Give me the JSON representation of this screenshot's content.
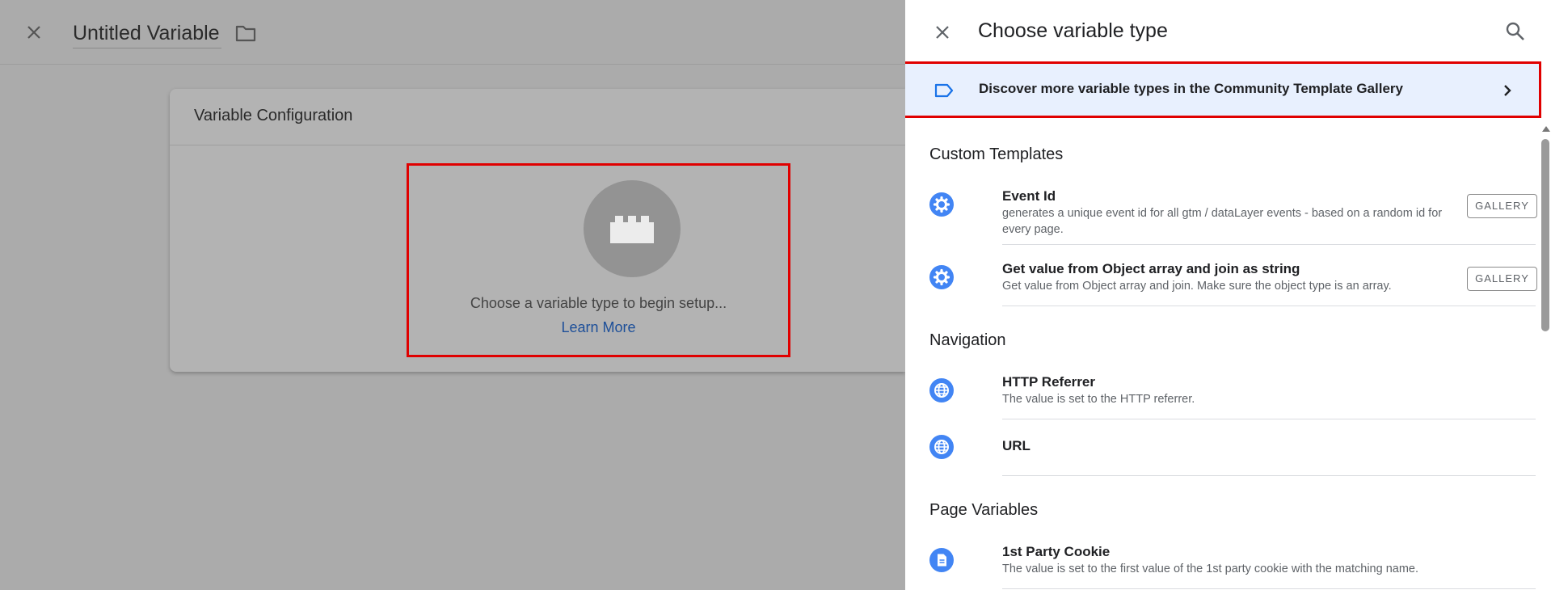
{
  "editor": {
    "title": "Untitled Variable",
    "card_title": "Variable Configuration",
    "empty_text": "Choose a variable type to begin setup...",
    "learn_more": "Learn More"
  },
  "drawer": {
    "title": "Choose variable type",
    "banner": "Discover more variable types in the Community Template Gallery",
    "sections": {
      "custom": {
        "title": "Custom Templates",
        "items": [
          {
            "name": "Event Id",
            "desc": "generates a unique event id for all gtm / dataLayer events - based on a random id for every page.",
            "button": "GALLERY"
          },
          {
            "name": "Get value from Object array and join as string",
            "desc": "Get value from Object array and join. Make sure the object type is an array.",
            "button": "GALLERY"
          }
        ]
      },
      "navigation": {
        "title": "Navigation",
        "items": [
          {
            "name": "HTTP Referrer",
            "desc": "The value is set to the HTTP referrer."
          },
          {
            "name": "URL",
            "desc": ""
          }
        ]
      },
      "page": {
        "title": "Page Variables",
        "items": [
          {
            "name": "1st Party Cookie",
            "desc": "The value is set to the first value of the 1st party cookie with the matching name."
          }
        ]
      }
    }
  },
  "colors": {
    "accent": "#4285f4",
    "banner_bg": "#e8f0fe",
    "highlight": "#e00000"
  },
  "icons": {
    "close": "close-icon",
    "folder": "folder-icon",
    "search": "search-icon",
    "tag": "tag-icon",
    "chevron": "chevron-right-icon",
    "gear": "gear-icon",
    "globe": "globe-icon",
    "document": "document-icon",
    "brick": "brick-icon"
  }
}
